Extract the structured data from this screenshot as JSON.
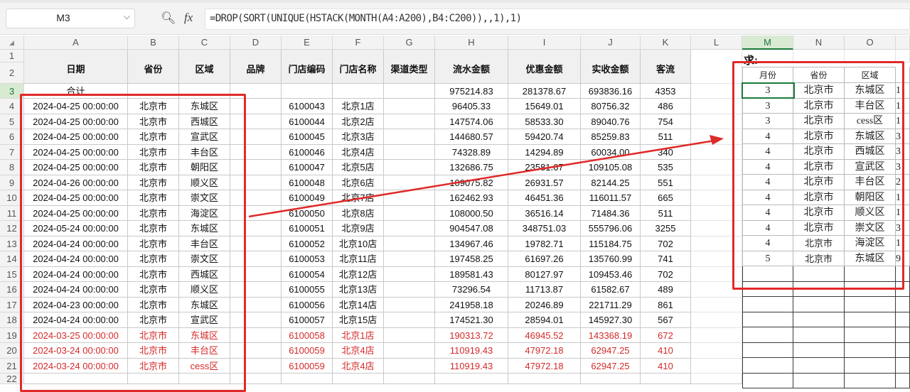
{
  "namebox": {
    "ref": "M3"
  },
  "formula": "=DROP(SORT(UNIQUE(HSTACK(MONTH(A4:A200),B4:C200)),,1),1)",
  "icons": {
    "zoom": "zoom-icon",
    "fx": "fx-icon"
  },
  "fx_label": "fx",
  "columns": [
    "A",
    "B",
    "C",
    "D",
    "E",
    "F",
    "G",
    "H",
    "I",
    "J",
    "K",
    "L",
    "M",
    "N",
    "O"
  ],
  "rows": [
    "1",
    "2",
    "3",
    "4",
    "5",
    "6",
    "7",
    "8",
    "9",
    "10",
    "11",
    "12",
    "13",
    "14",
    "15",
    "16",
    "17",
    "18",
    "19",
    "20",
    "21",
    "22"
  ],
  "headers": [
    "日期",
    "省份",
    "区域",
    "品牌",
    "门店编码",
    "门店名称",
    "渠道类型",
    "流水金额",
    "优惠金额",
    "实收金额",
    "客流"
  ],
  "total_row": {
    "label": "合计",
    "liushui": "975214.83",
    "youhui": "281378.67",
    "shishou": "693836.16",
    "keliu": "4353"
  },
  "data_rows": [
    [
      "2024-04-25 00:00:00",
      "北京市",
      "东城区",
      "",
      "6100043",
      "北京1店",
      "",
      "96405.33",
      "15649.01",
      "80756.32",
      "486"
    ],
    [
      "2024-04-25 00:00:00",
      "北京市",
      "西城区",
      "",
      "6100044",
      "北京2店",
      "",
      "147574.06",
      "58533.30",
      "89040.76",
      "754"
    ],
    [
      "2024-04-25 00:00:00",
      "北京市",
      "宣武区",
      "",
      "6100045",
      "北京3店",
      "",
      "144680.57",
      "59420.74",
      "85259.83",
      "511"
    ],
    [
      "2024-04-25 00:00:00",
      "北京市",
      "丰台区",
      "",
      "6100046",
      "北京4店",
      "",
      "74328.89",
      "14294.89",
      "60034.00",
      "340"
    ],
    [
      "2024-04-25 00:00:00",
      "北京市",
      "朝阳区",
      "",
      "6100047",
      "北京5店",
      "",
      "132686.75",
      "23581.67",
      "109105.08",
      "535"
    ],
    [
      "2024-04-26 00:00:00",
      "北京市",
      "顺义区",
      "",
      "6100048",
      "北京6店",
      "",
      "109075.82",
      "26931.57",
      "82144.25",
      "551"
    ],
    [
      "2024-04-25 00:00:00",
      "北京市",
      "崇文区",
      "",
      "6100049",
      "北京7店",
      "",
      "162462.93",
      "46451.36",
      "116011.57",
      "665"
    ],
    [
      "2024-04-25 00:00:00",
      "北京市",
      "海淀区",
      "",
      "6100050",
      "北京8店",
      "",
      "108000.50",
      "36516.14",
      "71484.36",
      "511"
    ],
    [
      "2024-05-24 00:00:00",
      "北京市",
      "东城区",
      "",
      "6100051",
      "北京9店",
      "",
      "904547.08",
      "348751.03",
      "555796.06",
      "3255"
    ],
    [
      "2024-04-24 00:00:00",
      "北京市",
      "丰台区",
      "",
      "6100052",
      "北京10店",
      "",
      "134967.46",
      "19782.71",
      "115184.75",
      "702"
    ],
    [
      "2024-04-24 00:00:00",
      "北京市",
      "崇文区",
      "",
      "6100053",
      "北京11店",
      "",
      "197458.25",
      "61697.26",
      "135760.99",
      "741"
    ],
    [
      "2024-04-24 00:00:00",
      "北京市",
      "西城区",
      "",
      "6100054",
      "北京12店",
      "",
      "189581.43",
      "80127.97",
      "109453.46",
      "702"
    ],
    [
      "2024-04-24 00:00:00",
      "北京市",
      "顺义区",
      "",
      "6100055",
      "北京13店",
      "",
      "73296.54",
      "11713.87",
      "61582.67",
      "489"
    ],
    [
      "2024-04-23 00:00:00",
      "北京市",
      "东城区",
      "",
      "6100056",
      "北京14店",
      "",
      "241958.18",
      "20246.89",
      "221711.29",
      "861"
    ],
    [
      "2024-04-24 00:00:00",
      "北京市",
      "宣武区",
      "",
      "6100057",
      "北京15店",
      "",
      "174521.30",
      "28594.01",
      "145927.30",
      "567"
    ],
    [
      "2024-03-25 00:00:00",
      "北京市",
      "东城区",
      "",
      "6100058",
      "北京1店",
      "",
      "190313.72",
      "46945.52",
      "143368.19",
      "672"
    ],
    [
      "2024-03-24 00:00:00",
      "北京市",
      "丰台区",
      "",
      "6100059",
      "北京4店",
      "",
      "110919.43",
      "47972.18",
      "62947.25",
      "410"
    ],
    [
      "2024-03-24 00:00:00",
      "北京市",
      "cess区",
      "",
      "6100059",
      "北京4店",
      "",
      "110919.43",
      "47972.18",
      "62947.25",
      "410"
    ]
  ],
  "red_rows_from": 15,
  "result": {
    "title": "求:",
    "headers": [
      "月份",
      "省份",
      "区域"
    ],
    "rows": [
      [
        "3",
        "北京市",
        "东城区",
        "1"
      ],
      [
        "3",
        "北京市",
        "丰台区",
        "1"
      ],
      [
        "3",
        "北京市",
        "cess区",
        "1"
      ],
      [
        "4",
        "北京市",
        "东城区",
        "3"
      ],
      [
        "4",
        "北京市",
        "西城区",
        "3"
      ],
      [
        "4",
        "北京市",
        "宣武区",
        "3"
      ],
      [
        "4",
        "北京市",
        "丰台区",
        "2"
      ],
      [
        "4",
        "北京市",
        "朝阳区",
        "1"
      ],
      [
        "4",
        "北京市",
        "顺义区",
        "1"
      ],
      [
        "4",
        "北京市",
        "崇文区",
        "3"
      ],
      [
        "4",
        "北京市",
        "海淀区",
        "1"
      ],
      [
        "5",
        "北京市",
        "东城区",
        "9"
      ]
    ]
  },
  "colors": {
    "red_highlight": "#e02a2a",
    "active_green": "#1a7a3c",
    "red_text": "#d42a2a"
  }
}
